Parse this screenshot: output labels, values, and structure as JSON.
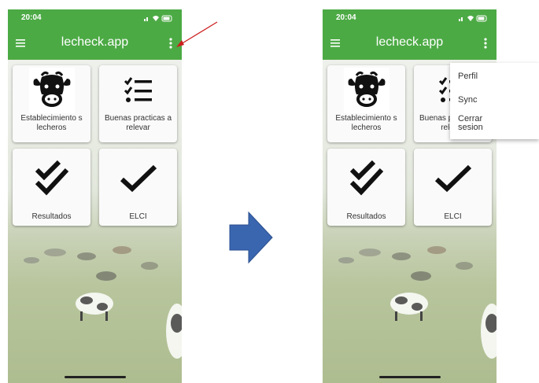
{
  "status": {
    "time": "20:04"
  },
  "app": {
    "title": "lecheck.app"
  },
  "tiles": [
    {
      "label": "Establecimiento s lecheros",
      "icon": "cow-icon"
    },
    {
      "label": "Buenas practicas a relevar",
      "icon": "checklist-icon"
    },
    {
      "label": "Resultados",
      "icon": "double-check-icon"
    },
    {
      "label": "ELCI",
      "icon": "check-icon"
    }
  ],
  "menu": {
    "items": [
      "Perfil",
      "Sync",
      "Cerrar sesion"
    ]
  },
  "colors": {
    "appbar": "#4caa45",
    "annotation_arrow": "#cc1f1f",
    "transition_arrow": "#3a66b0"
  }
}
